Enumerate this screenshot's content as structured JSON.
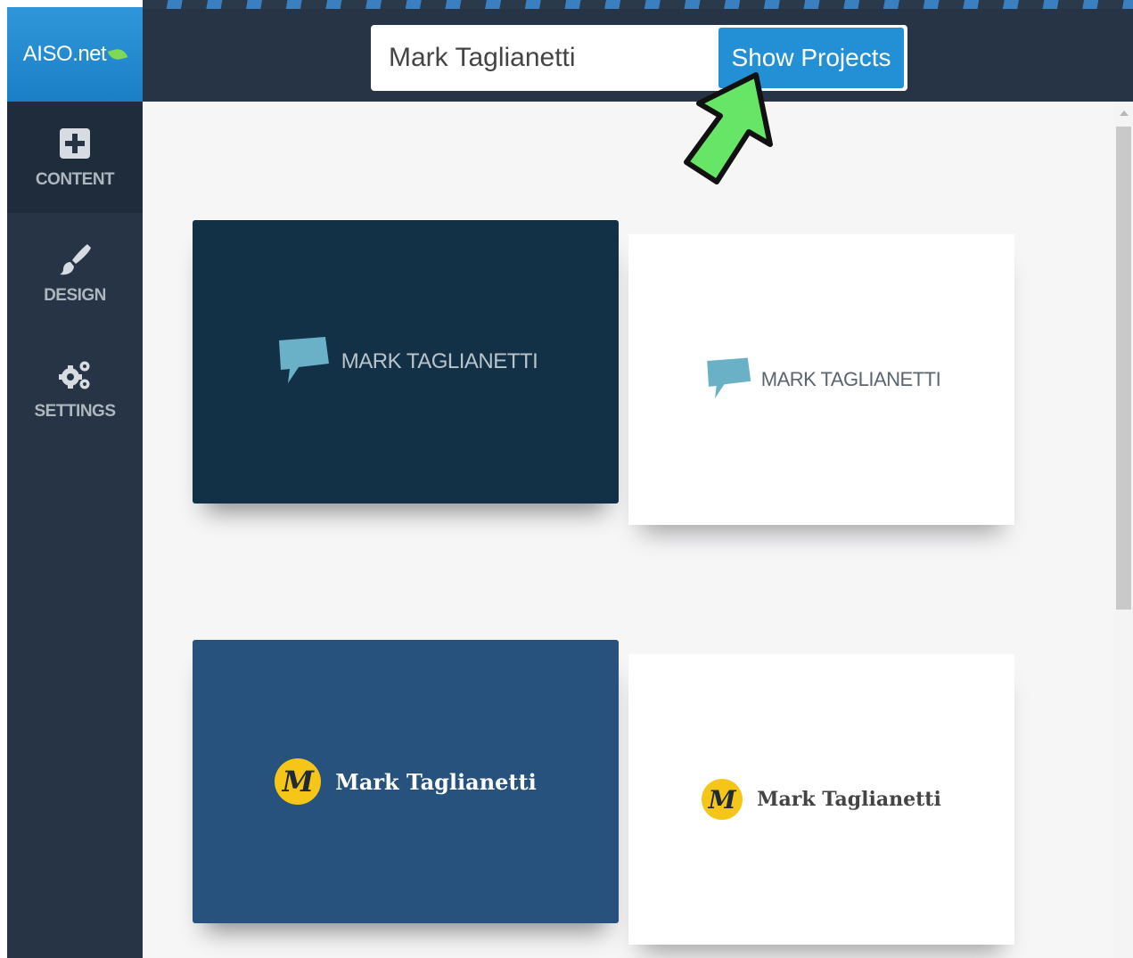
{
  "brand": {
    "logo_text": "AISO.net"
  },
  "header": {
    "search_value": "Mark Taglianetti",
    "button_label": "Show Projects"
  },
  "sidebar": {
    "items": [
      {
        "label": "CONTENT",
        "icon": "plus-square-icon"
      },
      {
        "label": "DESIGN",
        "icon": "paintbrush-icon"
      },
      {
        "label": "SETTINGS",
        "icon": "gears-icon"
      }
    ]
  },
  "logos": [
    {
      "name": "MARK TAGLIANETTI",
      "icon": "speech-bubble-icon",
      "background": "#133146",
      "text_color": "#b9c4ca"
    },
    {
      "name": "MARK TAGLIANETTI",
      "icon": "speech-bubble-icon",
      "background": "#ffffff",
      "text_color": "#5a6570"
    },
    {
      "name": "Mark Taglianetti",
      "icon": "m-badge-icon",
      "background": "#28527e",
      "text_color": "#ffffff"
    },
    {
      "name": "Mark Taglianetti",
      "icon": "m-badge-icon",
      "background": "#ffffff",
      "text_color": "#444444"
    }
  ],
  "colors": {
    "header_bg": "#263445",
    "accent_blue": "#2390d6",
    "bubble_teal": "#6ab0c6",
    "badge_yellow": "#f5c518",
    "arrow_green": "#66e566"
  }
}
